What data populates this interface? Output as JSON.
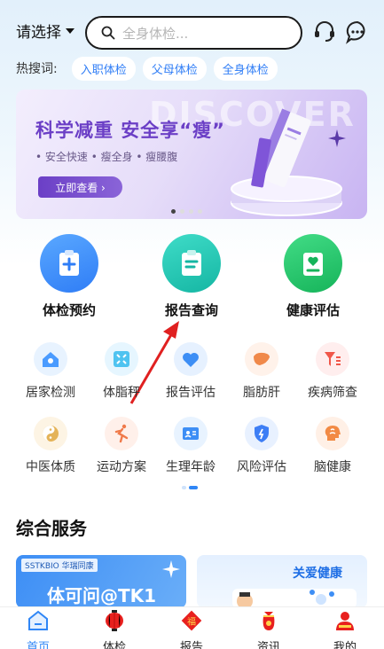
{
  "header": {
    "city_label": "请选择",
    "search_placeholder": "全身体检..."
  },
  "hot_search": {
    "label": "热搜词:",
    "tags": [
      "入职体检",
      "父母体检",
      "全身体检"
    ]
  },
  "banner": {
    "watermark": "DISCOVER",
    "title": "科学减重  安全享“瘦”",
    "features": "• 安全快速  • 瘦全身  • 瘦腰腹",
    "cta": "立即查看 ›"
  },
  "main_services": [
    {
      "label": "体检预约",
      "color": "#2f86f6"
    },
    {
      "label": "报告查询",
      "color": "#1fc2b0"
    },
    {
      "label": "健康评估",
      "color": "#22c56a"
    }
  ],
  "grid_row1": [
    {
      "label": "居家检测",
      "icon": "house-icon"
    },
    {
      "label": "体脂秤",
      "icon": "scale-icon"
    },
    {
      "label": "报告评估",
      "icon": "heart-icon"
    },
    {
      "label": "脂肪肝",
      "icon": "liver-icon"
    },
    {
      "label": "疾病筛查",
      "icon": "filter-icon"
    }
  ],
  "grid_row2": [
    {
      "label": "中医体质",
      "icon": "yin-yang-icon"
    },
    {
      "label": "运动方案",
      "icon": "runner-icon"
    },
    {
      "label": "生理年龄",
      "icon": "id-card-icon"
    },
    {
      "label": "风险评估",
      "icon": "shield-icon"
    },
    {
      "label": "脑健康",
      "icon": "brain-icon"
    }
  ],
  "section": {
    "title": "综合服务",
    "card1_brand": "SSTKBIO 华瑞同康",
    "card1_text": "体可问@TK1",
    "card2_text": "关爱健康"
  },
  "nav": {
    "items": [
      "首页",
      "体检",
      "报告",
      "资讯",
      "我的"
    ],
    "active": "首页"
  },
  "colors": {
    "accent": "#2f86f6",
    "banner_purple": "#6b3fc6"
  }
}
